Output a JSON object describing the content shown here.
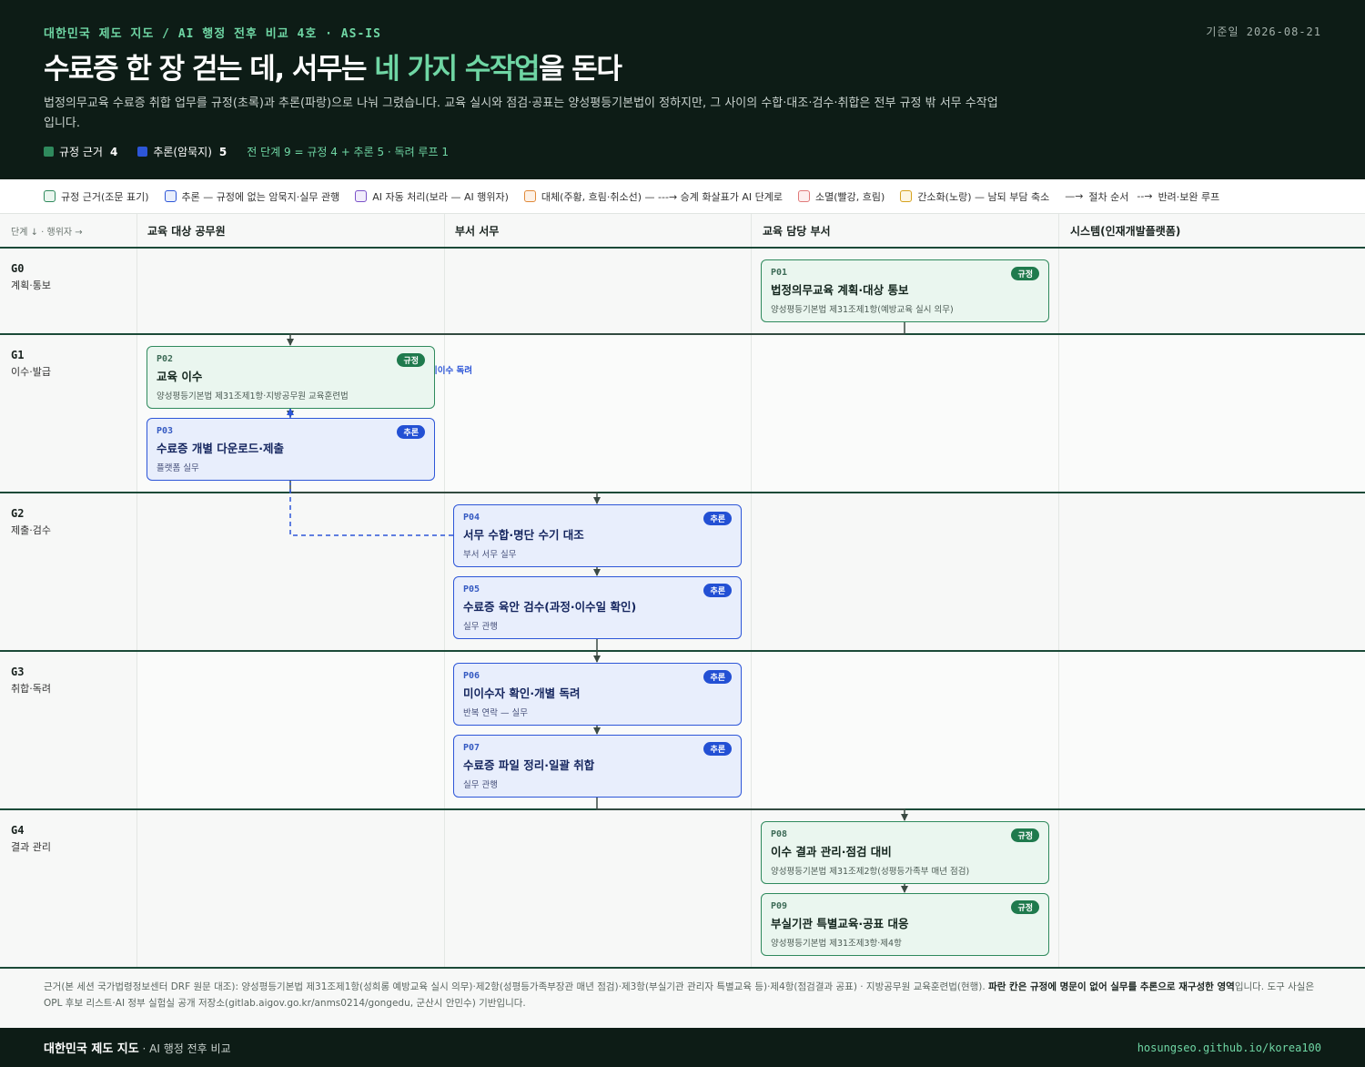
{
  "header": {
    "kicker": "대한민국 제도 지도 / AI 행정 전후 비교 4호 · AS-IS",
    "base_date": "기준일 2026-08-21",
    "title_pre": "수료증 한 장 걷는 데, 서무는 ",
    "title_highlight": "네 가지 수작업",
    "title_post": "을 돈다",
    "lede": "법정의무교육 수료증 취합 업무를 규정(초록)과 추론(파랑)으로 나눠 그렸습니다. 교육 실시와 점검·공표는 양성평등기본법이 정하지만, 그 사이의 수합·대조·검수·취합은 전부 규정 밖 서무 수작업입니다.",
    "count_reg_label": "규정 근거",
    "count_reg_value": "4",
    "count_inf_label": "추론(암묵지)",
    "count_inf_value": "5",
    "count_total": "전 단계 9 = 규정 4 + 추론 5 · 독려 루프 1"
  },
  "legend": [
    {
      "label": "규정 근거(조문 표기)",
      "color": "#2f8a5d",
      "fill": "#eaf6ef"
    },
    {
      "label": "추론 — 규정에 없는 암묵지·실무 관행",
      "color": "#2d56d8",
      "fill": "#e8eefc"
    },
    {
      "label": "AI 자동 처리(보라 — AI 행위자)",
      "color": "#7b52c9",
      "fill": "#f1ecfb"
    },
    {
      "label": "대체(주황, 흐림·취소선) — ---→ 승계 화살표가 AI 단계로",
      "color": "#e08a3a",
      "fill": "#fdf1e6"
    },
    {
      "label": "소멸(빨강, 흐림)",
      "color": "#e07a7a",
      "fill": "#fdeeee"
    },
    {
      "label": "간소화(노랑) — 남되 부담 축소",
      "color": "#d6a21e",
      "fill": "#fdf6e2"
    }
  ],
  "legend_arrows": {
    "solid": "절차 순서",
    "dashed": "반려·보완 루프"
  },
  "columns": {
    "corner": "단계 ↓ · 행위자 →",
    "c1": "교육 대상 공무원",
    "c2": "부서 서무",
    "c3": "교육 담당 부서",
    "c4": "시스템(인재개발플랫폼)"
  },
  "stages": [
    {
      "id": "G0",
      "name": "계획·통보"
    },
    {
      "id": "G1",
      "name": "이수·발급"
    },
    {
      "id": "G2",
      "name": "제출·검수"
    },
    {
      "id": "G3",
      "name": "취합·독려"
    },
    {
      "id": "G4",
      "name": "결과 관리"
    }
  ],
  "cards": [
    {
      "id": "P01",
      "title": "법정의무교육 계획·대상 통보",
      "sub": "양성평등기본법 제31조제1항(예방교육 실시 의무)",
      "badge": "규정",
      "kind": "reg"
    },
    {
      "id": "P02",
      "title": "교육 이수",
      "sub": "양성평등기본법 제31조제1항·지방공무원 교육훈련법",
      "badge": "규정",
      "kind": "reg"
    },
    {
      "id": "P03",
      "title": "수료증 개별 다운로드·제출",
      "sub": "플랫폼 실무",
      "badge": "추론",
      "kind": "inf"
    },
    {
      "id": "P04",
      "title": "서무 수합·명단 수기 대조",
      "sub": "부서 서무 실무",
      "badge": "추론",
      "kind": "inf"
    },
    {
      "id": "P05",
      "title": "수료증 육안 검수(과정·이수일 확인)",
      "sub": "실무 관행",
      "badge": "추론",
      "kind": "inf"
    },
    {
      "id": "P06",
      "title": "미이수자 확인·개별 독려",
      "sub": "반복 연락 — 실무",
      "badge": "추론",
      "kind": "inf"
    },
    {
      "id": "P07",
      "title": "수료증 파일 정리·일괄 취합",
      "sub": "실무 관행",
      "badge": "추론",
      "kind": "inf"
    },
    {
      "id": "P08",
      "title": "이수 결과 관리·점검 대비",
      "sub": "양성평등기본법 제31조제2항(성평등가족부 매년 점검)",
      "badge": "규정",
      "kind": "reg"
    },
    {
      "id": "P09",
      "title": "부실기관 특별교육·공표 대응",
      "sub": "양성평등기본법 제31조제3항·제4항",
      "badge": "규정",
      "kind": "reg"
    }
  ],
  "loop_label": "미이수 독려",
  "footnote": {
    "pre": "근거(본 세션 국가법령정보센터 DRF 원문 대조): 양성평등기본법 제31조제1항(성희롱 예방교육 실시 의무)·제2항(성평등가족부장관 매년 점검)·제3항(부실기관 관리자 특별교육 등)·제4항(점검결과 공표) · 지방공무원 교육훈련법(현행). ",
    "bold": "파란 칸은 규정에 명문이 없어 실무를 추론으로 재구성한 영역",
    "post": "입니다. 도구 사실은 OPL 후보 리스트·AI 정부 실험실 공개 저장소(gitlab.aigov.go.kr/anms0214/gongedu, 군산시 안민수) 기반입니다."
  },
  "footer": {
    "brand": "대한민국 제도 지도",
    "brand_sub": " · AI 행정 전후 비교",
    "url": "hosungseo.github.io/korea100"
  },
  "colors": {
    "header_bg": "#0d1c16",
    "accent": "#6fd6a4",
    "regulation": "#2f8a5d",
    "inference": "#2d56d8"
  }
}
